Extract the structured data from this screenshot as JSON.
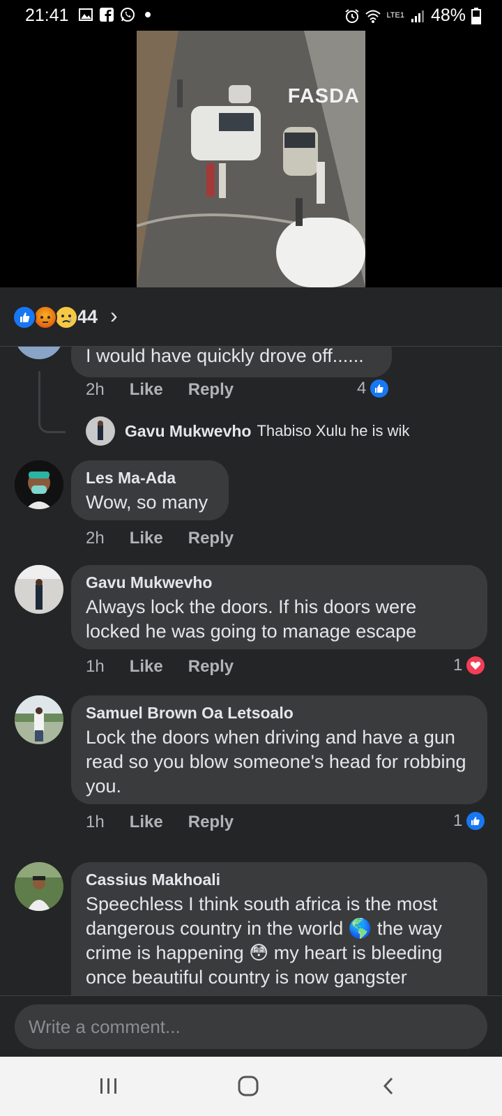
{
  "status_bar": {
    "time": "21:41",
    "battery": "48%",
    "network": "LTE1"
  },
  "video": {
    "watermark": "FASDA"
  },
  "reactions": {
    "count": "44",
    "icons": [
      "like-icon",
      "angry-icon",
      "sad-icon"
    ]
  },
  "comments": [
    {
      "text": "I would have quickly drove off......",
      "time": "2h",
      "like_label": "Like",
      "reply_label": "Reply",
      "reaction_count": "4",
      "reaction_type": "like"
    },
    {
      "reply_author": "Gavu Mukwevho",
      "reply_text": "Thabiso Xulu he is wik"
    },
    {
      "author": "Les Ma-Ada",
      "text": "Wow, so many",
      "time": "2h",
      "like_label": "Like",
      "reply_label": "Reply"
    },
    {
      "author": "Gavu Mukwevho",
      "text": "Always lock the doors. If his doors were locked he was going to manage escape",
      "time": "1h",
      "like_label": "Like",
      "reply_label": "Reply",
      "reaction_count": "1",
      "reaction_type": "love"
    },
    {
      "author": "Samuel Brown Oa Letsoalo",
      "text": "Lock the doors when  driving and have a gun read so you blow someone's head for robbing you.",
      "time": "1h",
      "like_label": "Like",
      "reply_label": "Reply",
      "reaction_count": "1",
      "reaction_type": "like"
    },
    {
      "author": "Cassius Makhoali",
      "text": "Speechless  I think south africa is the most dangerous country in the world 🌎 the way crime is happening 😳  my heart is bleeding once beautiful country is now gangster"
    }
  ],
  "composer": {
    "placeholder": "Write a comment..."
  },
  "colors": {
    "background": "#242526",
    "bubble": "#3a3b3c",
    "like_blue": "#1877f2",
    "love_red": "#f33e58"
  }
}
